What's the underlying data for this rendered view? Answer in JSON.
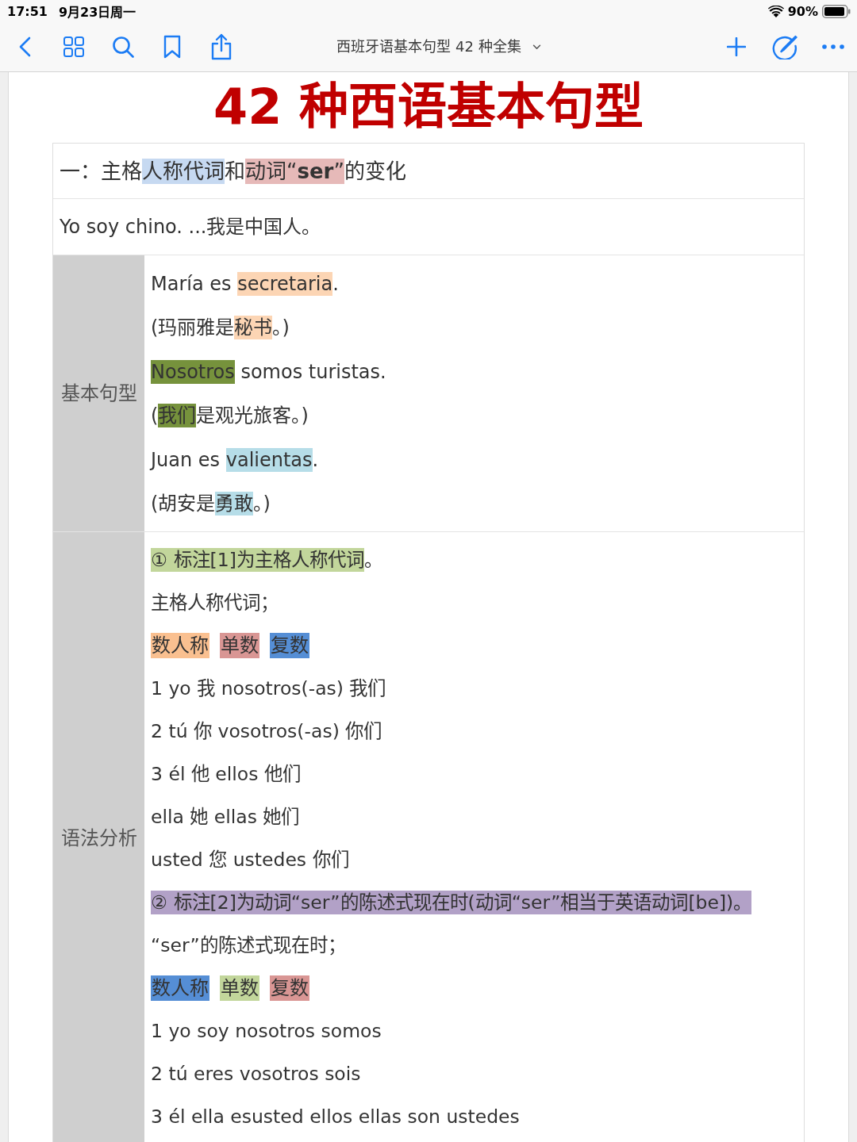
{
  "status_bar": {
    "time": "17:51",
    "date": "9月23日周一",
    "battery": "90%"
  },
  "toolbar": {
    "title": "西班牙语基本句型 42 种全集"
  },
  "document": {
    "title": "42 种西语基本句型",
    "heading": [
      {
        "text": "一：主格"
      },
      {
        "text": "人称代词",
        "color": "#c6d9f1"
      },
      {
        "text": "和"
      },
      {
        "text": "动词“**ser**”",
        "color": "#e6b9b8"
      },
      {
        "text": "的变化"
      }
    ],
    "example": [
      {
        "text": "Yo soy chino. ...我是中国人。"
      }
    ],
    "sections": [
      {
        "label": "基本句型",
        "lines": [
          {
            "kind": "text",
            "segments": [
              {
                "text": "María es "
              },
              {
                "text": "secretaria",
                "color": "#fcd5b4"
              },
              {
                "text": "."
              }
            ]
          },
          {
            "kind": "text",
            "segments": [
              {
                "text": "(玛丽雅是"
              },
              {
                "text": "秘书",
                "color": "#fcd5b4"
              },
              {
                "text": "。)"
              }
            ]
          },
          {
            "kind": "text",
            "segments": [
              {
                "text": "Nosotros",
                "color": "#76923c"
              },
              {
                "text": " somos turistas."
              }
            ]
          },
          {
            "kind": "text",
            "segments": [
              {
                "text": "("
              },
              {
                "text": "我们",
                "color": "#76923c"
              },
              {
                "text": "是观光旅客。)"
              }
            ]
          },
          {
            "kind": "text",
            "segments": [
              {
                "text": "Juan es "
              },
              {
                "text": "valientas",
                "color": "#b6dde8"
              },
              {
                "text": "."
              }
            ]
          },
          {
            "kind": "text",
            "segments": [
              {
                "text": "(胡安是"
              },
              {
                "text": "勇敢",
                "color": "#b6dde8"
              },
              {
                "text": "。)"
              }
            ]
          }
        ]
      },
      {
        "label": "语法分析",
        "lines": [
          {
            "kind": "text",
            "segments": [
              {
                "text": "① 标注[1]为主格人称代词",
                "color": "#c2d69b"
              },
              {
                "text": "。"
              }
            ]
          },
          {
            "kind": "text",
            "segments": [
              {
                "text": "主格人称代词；"
              }
            ]
          },
          {
            "kind": "tags",
            "tags": [
              {
                "text": "数人称",
                "color": "#fac090"
              },
              {
                "text": "单数",
                "color": "#d99694"
              },
              {
                "text": "复数",
                "color": "#558ed5"
              }
            ]
          },
          {
            "kind": "text",
            "segments": [
              {
                "text": "1 yo 我 nosotros(-as) 我们"
              }
            ]
          },
          {
            "kind": "text",
            "segments": [
              {
                "text": "2 tú 你 vosotros(-as) 你们"
              }
            ]
          },
          {
            "kind": "text",
            "segments": [
              {
                "text": "3 él 他 ellos 他们"
              }
            ]
          },
          {
            "kind": "text",
            "segments": [
              {
                "text": "ella 她 ellas 她们"
              }
            ]
          },
          {
            "kind": "text",
            "segments": [
              {
                "text": "usted 您 ustedes 你们"
              }
            ]
          },
          {
            "kind": "text",
            "segments": [
              {
                "text": "② 标注[2]为动词“ser”的陈述式现在时(动词“ser”相当于英语动词[be])。",
                "color": "#b2a1c7"
              }
            ]
          },
          {
            "kind": "text",
            "segments": [
              {
                "text": "“ser”的陈述式现在时；"
              }
            ]
          },
          {
            "kind": "tags",
            "tags": [
              {
                "text": "数人称",
                "color": "#558ed5"
              },
              {
                "text": "单数",
                "color": "#c2d69b"
              },
              {
                "text": "复数",
                "color": "#d99694"
              }
            ]
          },
          {
            "kind": "text",
            "segments": [
              {
                "text": "1 yo soy nosotros somos"
              }
            ]
          },
          {
            "kind": "text",
            "segments": [
              {
                "text": "2 tú eres vosotros sois"
              }
            ]
          },
          {
            "kind": "text",
            "segments": [
              {
                "text": "3 él ella esusted ellos ellas son ustedes"
              }
            ]
          }
        ]
      }
    ]
  }
}
